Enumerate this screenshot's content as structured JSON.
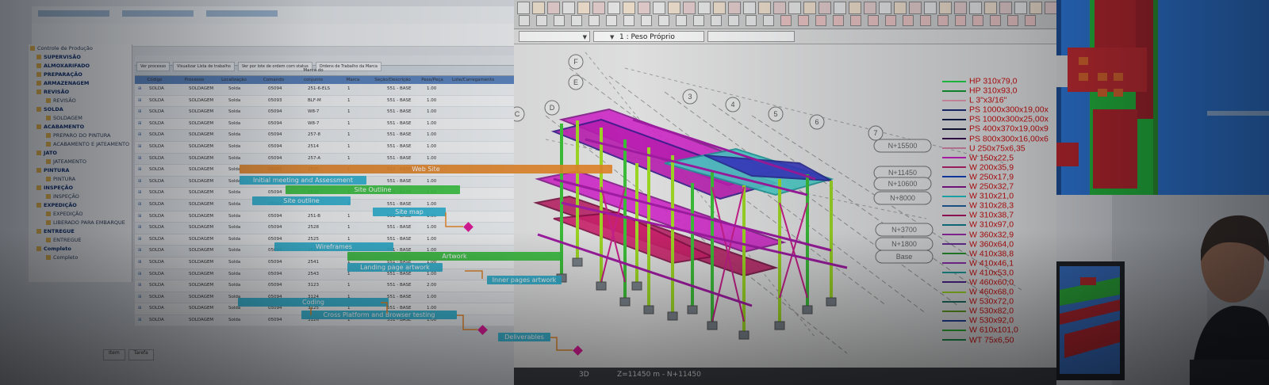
{
  "left": {
    "tree": [
      {
        "label": "Controle de Produção",
        "bold": false
      },
      {
        "label": "SUPERVISÃO",
        "bold": true
      },
      {
        "label": "ALMOXARIFADO",
        "bold": true
      },
      {
        "label": "PREPARAÇÃO",
        "bold": true
      },
      {
        "label": "ARMAZENAGEM",
        "bold": true
      },
      {
        "label": "REVISÃO",
        "bold": true
      },
      {
        "label": "REVISÃO",
        "bold": false
      },
      {
        "label": "SOLDA",
        "bold": true
      },
      {
        "label": "SOLDAGEM",
        "bold": false
      },
      {
        "label": "ACABAMENTO",
        "bold": true
      },
      {
        "label": "PREPARO DO PINTURA",
        "bold": false
      },
      {
        "label": "ACABAMENTO E JATEAMENTO",
        "bold": false
      },
      {
        "label": "JATO",
        "bold": true
      },
      {
        "label": "JATEAMENTO",
        "bold": false
      },
      {
        "label": "PINTURA",
        "bold": true
      },
      {
        "label": "PINTURA",
        "bold": false
      },
      {
        "label": "INSPEÇÃO",
        "bold": true
      },
      {
        "label": "INSPEÇÃO",
        "bold": false
      },
      {
        "label": "EXPEDIÇÃO",
        "bold": true
      },
      {
        "label": "EXPEDIÇÃO",
        "bold": false
      },
      {
        "label": "LIBERADO PARA EMBARQUE",
        "bold": false
      },
      {
        "label": "ENTREGUE",
        "bold": true
      },
      {
        "label": "ENTREGUE",
        "bold": false
      },
      {
        "label": "Completo",
        "bold": true
      },
      {
        "label": "Completo",
        "bold": false
      }
    ],
    "grid_tabs": [
      "Ver processo",
      "Visualizar Lista de trabalho",
      "Ver por lote de ordem com status",
      "Ordens de Trabalho da Marca"
    ],
    "grid_columns": [
      "Código",
      "Processo",
      "Localização",
      "Comando",
      "Marca do conjunto",
      "Marca",
      "Seção/Descrição",
      "Peso/Peça",
      "Lote/Carregamento",
      "Quantidade",
      "Quantidade concluída",
      "Quantidade total"
    ],
    "rows": [
      [
        "SOLDA",
        "SOLDAGEM",
        "Solda",
        "05094",
        "251-6-ELS",
        "1",
        "551 - BASE",
        "1.00"
      ],
      [
        "SOLDA",
        "SOLDAGEM",
        "Solda",
        "05093",
        "BLF-M",
        "1",
        "551 - BASE",
        "1.00"
      ],
      [
        "SOLDA",
        "SOLDAGEM",
        "Solda",
        "05094",
        "W8-7",
        "1",
        "551 - BASE",
        "1.00"
      ],
      [
        "SOLDA",
        "SOLDAGEM",
        "Solda",
        "05094",
        "W8-7",
        "1",
        "551 - BASE",
        "1.00"
      ],
      [
        "SOLDA",
        "SOLDAGEM",
        "Solda",
        "05094",
        "257-8",
        "1",
        "551 - BASE",
        "1.00"
      ],
      [
        "SOLDA",
        "SOLDAGEM",
        "Solda",
        "05094",
        "2514",
        "1",
        "551 - BASE",
        "1.00"
      ],
      [
        "SOLDA",
        "SOLDAGEM",
        "Solda",
        "05094",
        "257-A",
        "1",
        "551 - BASE",
        "1.00"
      ],
      [
        "SOLDA",
        "SOLDAGEM",
        "Solda",
        "05093",
        "2535",
        "1",
        "551 - BASE",
        "1.00"
      ],
      [
        "SOLDA",
        "SOLDAGEM",
        "Solda",
        "05094",
        "2537",
        "1",
        "551 - BASE",
        "1.00"
      ],
      [
        "SOLDA",
        "SOLDAGEM",
        "Solda",
        "05094",
        "2538",
        "1",
        "551 - BASE",
        "1.00"
      ],
      [
        "SOLDA",
        "SOLDAGEM",
        "Solda",
        "05094",
        "2539",
        "1",
        "551 - BASE",
        "1.00"
      ],
      [
        "SOLDA",
        "SOLDAGEM",
        "Solda",
        "05094",
        "251-B",
        "1",
        "551 - BASE",
        "1.00"
      ],
      [
        "SOLDA",
        "SOLDAGEM",
        "Solda",
        "05094",
        "2528",
        "1",
        "551 - BASE",
        "1.00"
      ],
      [
        "SOLDA",
        "SOLDAGEM",
        "Solda",
        "05094",
        "2525",
        "1",
        "551 - BASE",
        "1.00"
      ],
      [
        "SOLDA",
        "SOLDAGEM",
        "Solda",
        "05094",
        "2519",
        "1",
        "551 - BASE",
        "1.00"
      ],
      [
        "SOLDA",
        "SOLDAGEM",
        "Solda",
        "05094",
        "2541",
        "1",
        "551 - BASE",
        "1.00"
      ],
      [
        "SOLDA",
        "SOLDAGEM",
        "Solda",
        "05094",
        "2543",
        "1",
        "551 - BASE",
        "1.00"
      ],
      [
        "SOLDA",
        "SOLDAGEM",
        "Solda",
        "05094",
        "3123",
        "1",
        "551 - BASE",
        "2.00"
      ],
      [
        "SOLDA",
        "SOLDAGEM",
        "Solda",
        "05094",
        "3124",
        "1",
        "551 - BASE",
        "1.00"
      ],
      [
        "SOLDA",
        "SOLDAGEM",
        "Solda",
        "05094",
        "3125",
        "1",
        "551 - BASE",
        "1.00"
      ],
      [
        "SOLDA",
        "SOLDAGEM",
        "Solda",
        "05094",
        "3126",
        "1",
        "551 - BASE",
        "1.00"
      ]
    ],
    "bottom_tabs": [
      "Item",
      "Tarefa"
    ]
  },
  "gantt": {
    "tasks": [
      {
        "label": "Web Site",
        "color": "orange"
      },
      {
        "label": "Initial meeting and Assessment",
        "color": "cyan"
      },
      {
        "label": "Site Outline",
        "color": "green"
      },
      {
        "label": "Site outline",
        "color": "cyan"
      },
      {
        "label": "Site map",
        "color": "cyan"
      },
      {
        "label": "Wireframes",
        "color": "cyan"
      },
      {
        "label": "Artwork",
        "color": "green"
      },
      {
        "label": "Landing page artwork",
        "color": "cyan"
      },
      {
        "label": "Inner pages artwork",
        "color": "cyan"
      },
      {
        "label": "Coding",
        "color": "cyan"
      },
      {
        "label": "Cross Platform and Browser testing",
        "color": "cyan"
      },
      {
        "label": "Deliverables",
        "color": "cyan"
      }
    ],
    "milestone_color": "#e21c9b"
  },
  "center": {
    "load_case": "1 : Peso Próprio",
    "grid_axes": [
      "F",
      "E",
      "D",
      "C",
      "3",
      "4",
      "5",
      "6",
      "7"
    ],
    "levels": [
      "N+15500",
      "N+11450",
      "N+10600",
      "N+8000",
      "N+3700",
      "N+1800",
      "Base"
    ],
    "legend": [
      {
        "label": "HP 310x79,0",
        "color": "#22e04a"
      },
      {
        "label": "HP 310x93,0",
        "color": "#10a030"
      },
      {
        "label": "L 3\"x3/16\"",
        "color": "#f0a3b8"
      },
      {
        "label": "PS 1000x300x19,00x",
        "color": "#1a2a7a"
      },
      {
        "label": "PS 1000x300x25,00x",
        "color": "#0a1a4a"
      },
      {
        "label": "PS 400x370x19,00x9",
        "color": "#0d1030"
      },
      {
        "label": "PS 800x300x16,00x6",
        "color": "#3a1050"
      },
      {
        "label": "U 250x75x6,35",
        "color": "#e08ab0"
      },
      {
        "label": "W 150x22,5",
        "color": "#d020c8"
      },
      {
        "label": "W 200x35,9",
        "color": "#c02070"
      },
      {
        "label": "W 250x17,9",
        "color": "#1040c0"
      },
      {
        "label": "W 250x32,7",
        "color": "#8a1090"
      },
      {
        "label": "W 310x21,0",
        "color": "#20c8c8"
      },
      {
        "label": "W 310x28,3",
        "color": "#2060a0"
      },
      {
        "label": "W 310x38,7",
        "color": "#b01060"
      },
      {
        "label": "W 310x97,0",
        "color": "#108090"
      },
      {
        "label": "W 360x32,9",
        "color": "#a028b0"
      },
      {
        "label": "W 360x64,0",
        "color": "#7030a0"
      },
      {
        "label": "W 410x38,8",
        "color": "#2a9a2a"
      },
      {
        "label": "W 410x46,1",
        "color": "#9030b0"
      },
      {
        "label": "W 410x53,0",
        "color": "#1aa0a0"
      },
      {
        "label": "W 460x60,0",
        "color": "#502090"
      },
      {
        "label": "W 460x68,0",
        "color": "#a0e020"
      },
      {
        "label": "W 530x72,0",
        "color": "#1a7060"
      },
      {
        "label": "W 530x82,0",
        "color": "#60a020"
      },
      {
        "label": "W 530x92,0",
        "color": "#2040a0"
      },
      {
        "label": "W 610x101,0",
        "color": "#30b030"
      },
      {
        "label": "WT 75x6,50",
        "color": "#1a8a4a"
      }
    ],
    "status_mode": "3D",
    "status_text": "Z=11450 m - N+11450"
  }
}
